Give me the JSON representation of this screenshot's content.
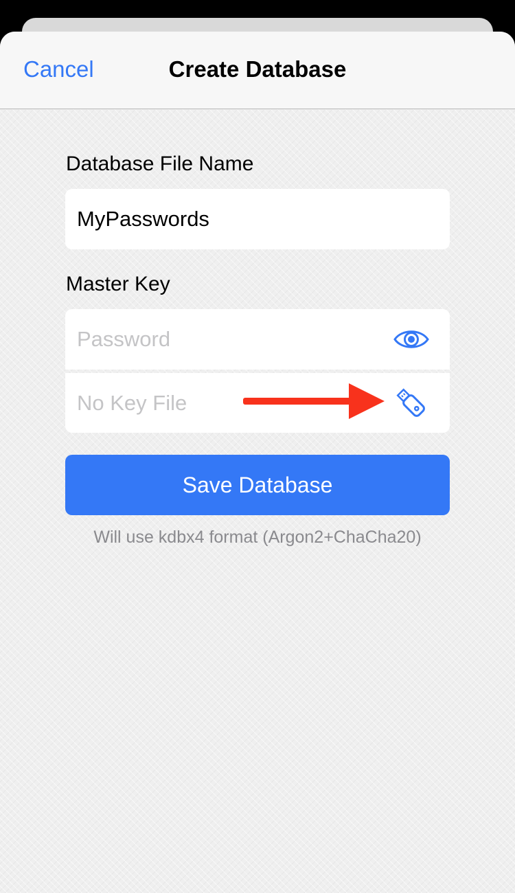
{
  "nav": {
    "cancel_label": "Cancel",
    "title": "Create Database"
  },
  "form": {
    "file_name_label": "Database File Name",
    "file_name_value": "MyPasswords",
    "master_key_label": "Master Key",
    "password_placeholder": "Password",
    "key_file_placeholder": "No Key File",
    "save_label": "Save Database",
    "format_note": "Will use kdbx4 format (Argon2+ChaCha20)"
  },
  "icons": {
    "password_toggle": "eye-icon",
    "key_file": "usb-drive-icon",
    "annotation": "red-arrow"
  },
  "colors": {
    "accent": "#3478f6",
    "annotation": "#f8321c",
    "placeholder": "#c4c4c6",
    "footnote": "#8a8a8e"
  }
}
